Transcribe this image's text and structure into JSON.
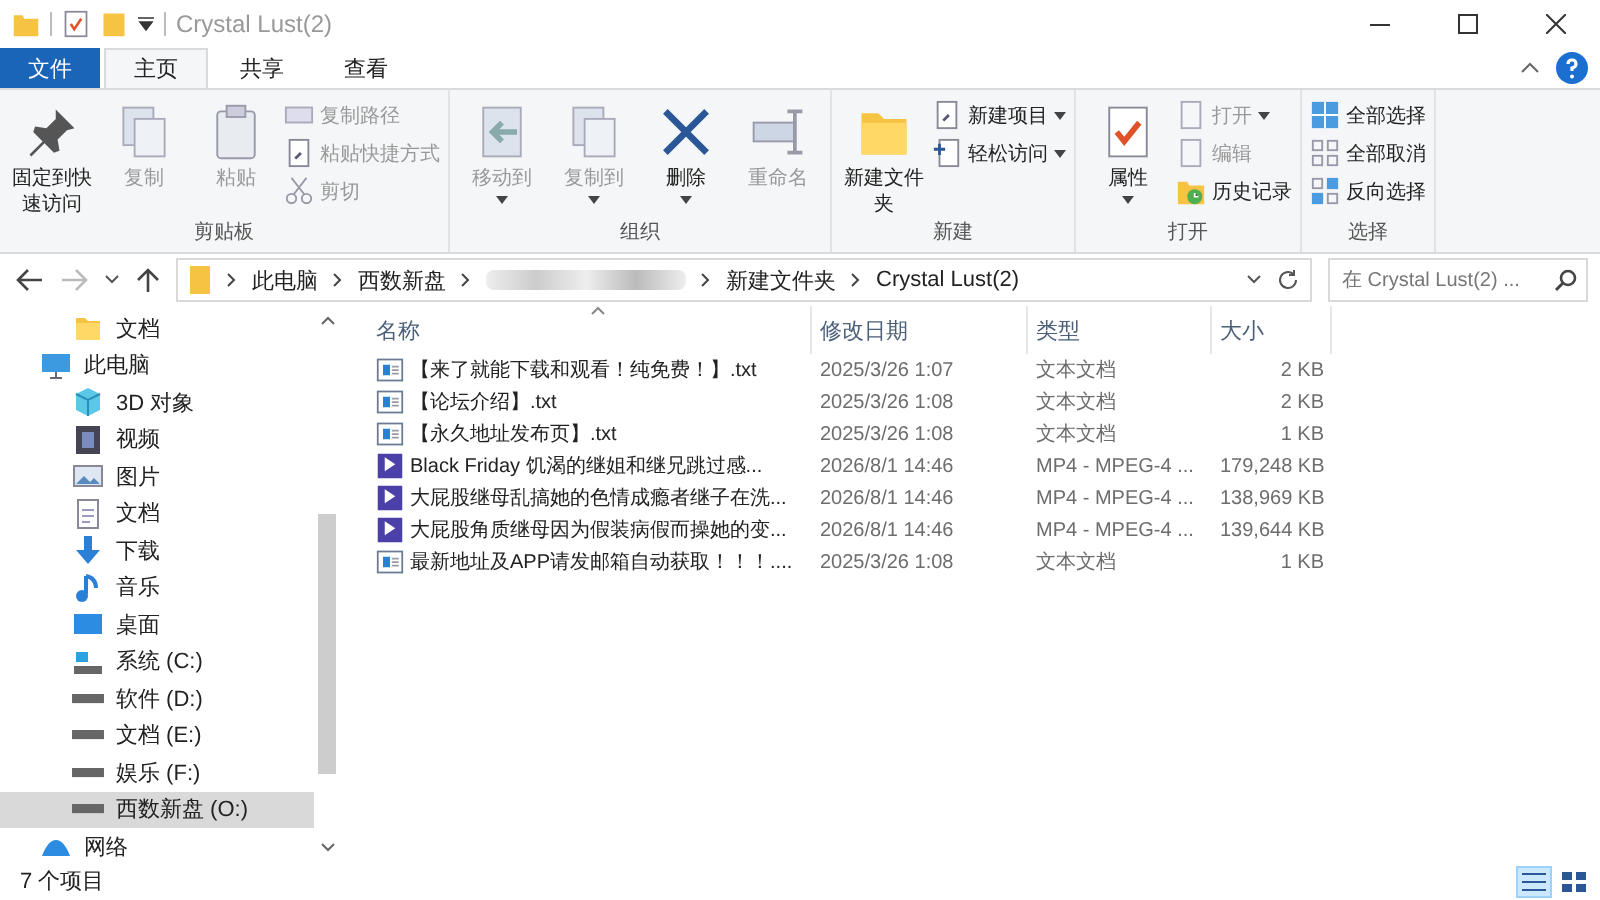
{
  "window": {
    "title": "Crystal Lust(2)"
  },
  "tabs": [
    {
      "label": "文件",
      "kind": "file",
      "selected": false
    },
    {
      "label": "主页",
      "kind": "tab",
      "selected": true
    },
    {
      "label": "共享",
      "kind": "tab",
      "selected": false
    },
    {
      "label": "查看",
      "kind": "tab",
      "selected": false
    }
  ],
  "ribbon": {
    "groups": [
      {
        "label": "剪贴板",
        "big": [
          {
            "label": "固定到快速访问",
            "kind": "pin",
            "disabled": false
          },
          {
            "label": "复制",
            "kind": "copy",
            "disabled": true
          },
          {
            "label": "粘贴",
            "kind": "paste",
            "disabled": true
          }
        ],
        "small": [
          {
            "label": "复制路径",
            "kind": "path",
            "disabled": true
          },
          {
            "label": "粘贴快捷方式",
            "kind": "shortcut",
            "disabled": true
          },
          {
            "label": "剪切",
            "kind": "cut",
            "disabled": true
          }
        ]
      },
      {
        "label": "组织",
        "big": [
          {
            "label": "移动到",
            "kind": "move",
            "disabled": true,
            "dropdown": true
          },
          {
            "label": "复制到",
            "kind": "copyto",
            "disabled": true,
            "dropdown": true
          },
          {
            "label": "删除",
            "kind": "delete",
            "disabled": false,
            "dropdown": true
          },
          {
            "label": "重命名",
            "kind": "rename",
            "disabled": true
          }
        ]
      },
      {
        "label": "新建",
        "big": [
          {
            "label": "新建文件夹",
            "kind": "folder",
            "disabled": false
          }
        ],
        "small": [
          {
            "label": "新建项目",
            "kind": "newitem",
            "disabled": false,
            "dropdown": true
          },
          {
            "label": "轻松访问",
            "kind": "easy",
            "disabled": false,
            "dropdown": true
          }
        ]
      },
      {
        "label": "打开",
        "big": [
          {
            "label": "属性",
            "kind": "props",
            "disabled": false,
            "dropdown": true
          }
        ],
        "small": [
          {
            "label": "打开",
            "kind": "open",
            "disabled": true,
            "dropdown": true
          },
          {
            "label": "编辑",
            "kind": "edit",
            "disabled": true
          },
          {
            "label": "历史记录",
            "kind": "history",
            "disabled": false
          }
        ]
      },
      {
        "label": "选择",
        "small": [
          {
            "label": "全部选择",
            "kind": "selall",
            "disabled": false
          },
          {
            "label": "全部取消",
            "kind": "selnone",
            "disabled": false
          },
          {
            "label": "反向选择",
            "kind": "selinv",
            "disabled": false
          }
        ]
      }
    ]
  },
  "address": {
    "crumbs": [
      {
        "label": "此电脑",
        "kind": "text"
      },
      {
        "label": "西数新盘",
        "kind": "text"
      },
      {
        "kind": "obscured"
      },
      {
        "label": "新建文件夹",
        "kind": "text"
      },
      {
        "label": "Crystal Lust(2)",
        "kind": "text"
      }
    ]
  },
  "search": {
    "placeholder": "在 Crystal Lust(2) ..."
  },
  "sidebar": {
    "items": [
      {
        "children": [
          {
            "label": "文档",
            "kind": "folder",
            "selected": false
          }
        ]
      },
      {
        "label": "此电脑",
        "kind": "pc",
        "selected": false,
        "children": [
          {
            "label": "3D 对象",
            "kind": "cube",
            "selected": false
          },
          {
            "label": "视频",
            "kind": "video",
            "selected": false
          },
          {
            "label": "图片",
            "kind": "image",
            "selected": false
          },
          {
            "label": "文档",
            "kind": "doc",
            "selected": false
          },
          {
            "label": "下载",
            "kind": "download",
            "selected": false
          },
          {
            "label": "音乐",
            "kind": "music",
            "selected": false
          },
          {
            "label": "桌面",
            "kind": "desktop",
            "selected": false
          },
          {
            "label": "系统 (C:)",
            "kind": "sysdrive",
            "selected": false
          },
          {
            "label": "软件 (D:)",
            "kind": "drive",
            "selected": false
          },
          {
            "label": "文档 (E:)",
            "kind": "drive",
            "selected": false
          },
          {
            "label": "娱乐 (F:)",
            "kind": "drive",
            "selected": false
          },
          {
            "label": "西数新盘 (O:)",
            "kind": "drive",
            "selected": true
          }
        ]
      },
      {
        "label": "网络",
        "kind": "network",
        "selected": false
      }
    ]
  },
  "table": {
    "columns": [
      {
        "label": "名称",
        "sorted": true
      },
      {
        "label": "修改日期",
        "sorted": false
      },
      {
        "label": "类型",
        "sorted": false
      },
      {
        "label": "大小",
        "sorted": false
      }
    ],
    "rows": [
      {
        "kind": "txt",
        "name": "【来了就能下载和观看！纯免费！】.txt",
        "date": "2025/3/26 1:07",
        "type": "文本文档",
        "size": "2 KB"
      },
      {
        "kind": "txt",
        "name": "【论坛介绍】.txt",
        "date": "2025/3/26 1:08",
        "type": "文本文档",
        "size": "2 KB"
      },
      {
        "kind": "txt",
        "name": "【永久地址发布页】.txt",
        "date": "2025/3/26 1:08",
        "type": "文本文档",
        "size": "1 KB"
      },
      {
        "kind": "video",
        "name": "Black Friday 饥渴的继姐和继兄跳过感...",
        "date": "2026/8/1 14:46",
        "type": "MP4 - MPEG-4 ...",
        "size": "179,248 KB"
      },
      {
        "kind": "video",
        "name": "大屁股继母乱搞她的色情成瘾者继子在洗...",
        "date": "2026/8/1 14:46",
        "type": "MP4 - MPEG-4 ...",
        "size": "138,969 KB"
      },
      {
        "kind": "video",
        "name": "大屁股角质继母因为假装病假而操她的变...",
        "date": "2026/8/1 14:46",
        "type": "MP4 - MPEG-4 ...",
        "size": "139,644 KB"
      },
      {
        "kind": "txt",
        "name": "最新地址及APP请发邮箱自动获取！！！....",
        "date": "2025/3/26 1:08",
        "type": "文本文档",
        "size": "1 KB"
      }
    ]
  },
  "status_bar": {
    "text": "7 个项目",
    "views": [
      {
        "kind": "details",
        "selected": true
      },
      {
        "kind": "tiles",
        "selected": false
      }
    ]
  }
}
